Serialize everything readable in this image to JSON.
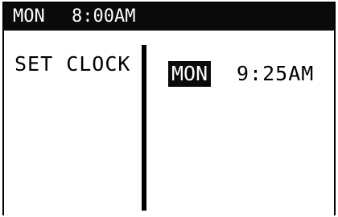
{
  "status_bar": {
    "day": "MON",
    "time": "8:00AM"
  },
  "menu": {
    "label": "SET CLOCK"
  },
  "clock_setting": {
    "day": "MON",
    "time": "9:25AM"
  },
  "colors": {
    "background": "#ffffff",
    "foreground": "#000000",
    "highlight_bg": "#0a0a0a",
    "highlight_fg": "#ffffff"
  }
}
